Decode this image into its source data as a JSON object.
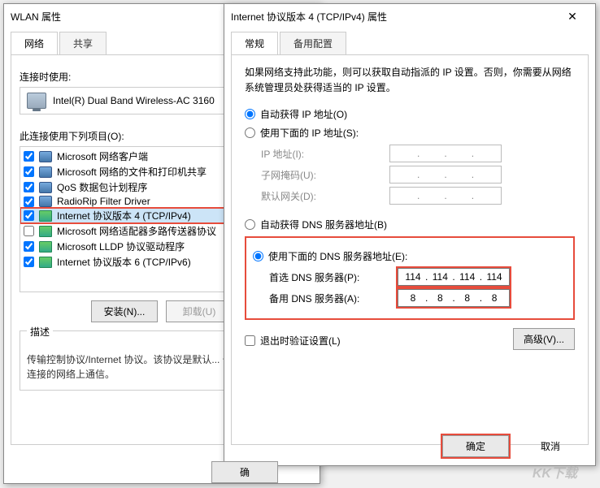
{
  "left": {
    "title": "WLAN 属性",
    "tabs": {
      "network": "网络",
      "share": "共享"
    },
    "connect_using": "连接时使用:",
    "adapter": "Intel(R) Dual Band Wireless-AC 3160",
    "items_label": "此连接使用下列项目(O):",
    "items": [
      {
        "label": "Microsoft 网络客户端",
        "checked": true,
        "icon": "net"
      },
      {
        "label": "Microsoft 网络的文件和打印机共享",
        "checked": true,
        "icon": "net"
      },
      {
        "label": "QoS 数据包计划程序",
        "checked": true,
        "icon": "net"
      },
      {
        "label": "RadioRip Filter Driver",
        "checked": true,
        "icon": "net"
      },
      {
        "label": "Internet 协议版本 4 (TCP/IPv4)",
        "checked": true,
        "icon": "green",
        "selected": true
      },
      {
        "label": "Microsoft 网络适配器多路传送器协议",
        "checked": false,
        "icon": "green"
      },
      {
        "label": "Microsoft LLDP 协议驱动程序",
        "checked": true,
        "icon": "green"
      },
      {
        "label": "Internet 协议版本 6 (TCP/IPv6)",
        "checked": true,
        "icon": "green"
      }
    ],
    "install_btn": "安装(N)...",
    "uninstall_btn": "卸载(U)",
    "desc_title": "描述",
    "desc_text": "传输控制协议/Internet 协议。该协议是默认... 于在不同的相互连接的网络上通信。",
    "bottom_ok": "确"
  },
  "right": {
    "title": "Internet 协议版本 4 (TCP/IPv4) 属性",
    "tabs": {
      "general": "常规",
      "alt": "备用配置"
    },
    "intro": "如果网络支持此功能，则可以获取自动指派的 IP 设置。否则，你需要从网络系统管理员处获得适当的 IP 设置。",
    "auto_ip": "自动获得 IP 地址(O)",
    "manual_ip": "使用下面的 IP 地址(S):",
    "ip_addr": "IP 地址(I):",
    "subnet": "子网掩码(U):",
    "gateway": "默认网关(D):",
    "auto_dns": "自动获得 DNS 服务器地址(B)",
    "manual_dns": "使用下面的 DNS 服务器地址(E):",
    "pref_dns": "首选 DNS 服务器(P):",
    "alt_dns": "备用 DNS 服务器(A):",
    "pref_dns_val": [
      "114",
      "114",
      "114",
      "114"
    ],
    "alt_dns_val": [
      "8",
      "8",
      "8",
      "8"
    ],
    "validate": "退出时验证设置(L)",
    "advanced": "高级(V)...",
    "ok": "确定",
    "cancel": "取消"
  },
  "watermark": "KK下载"
}
